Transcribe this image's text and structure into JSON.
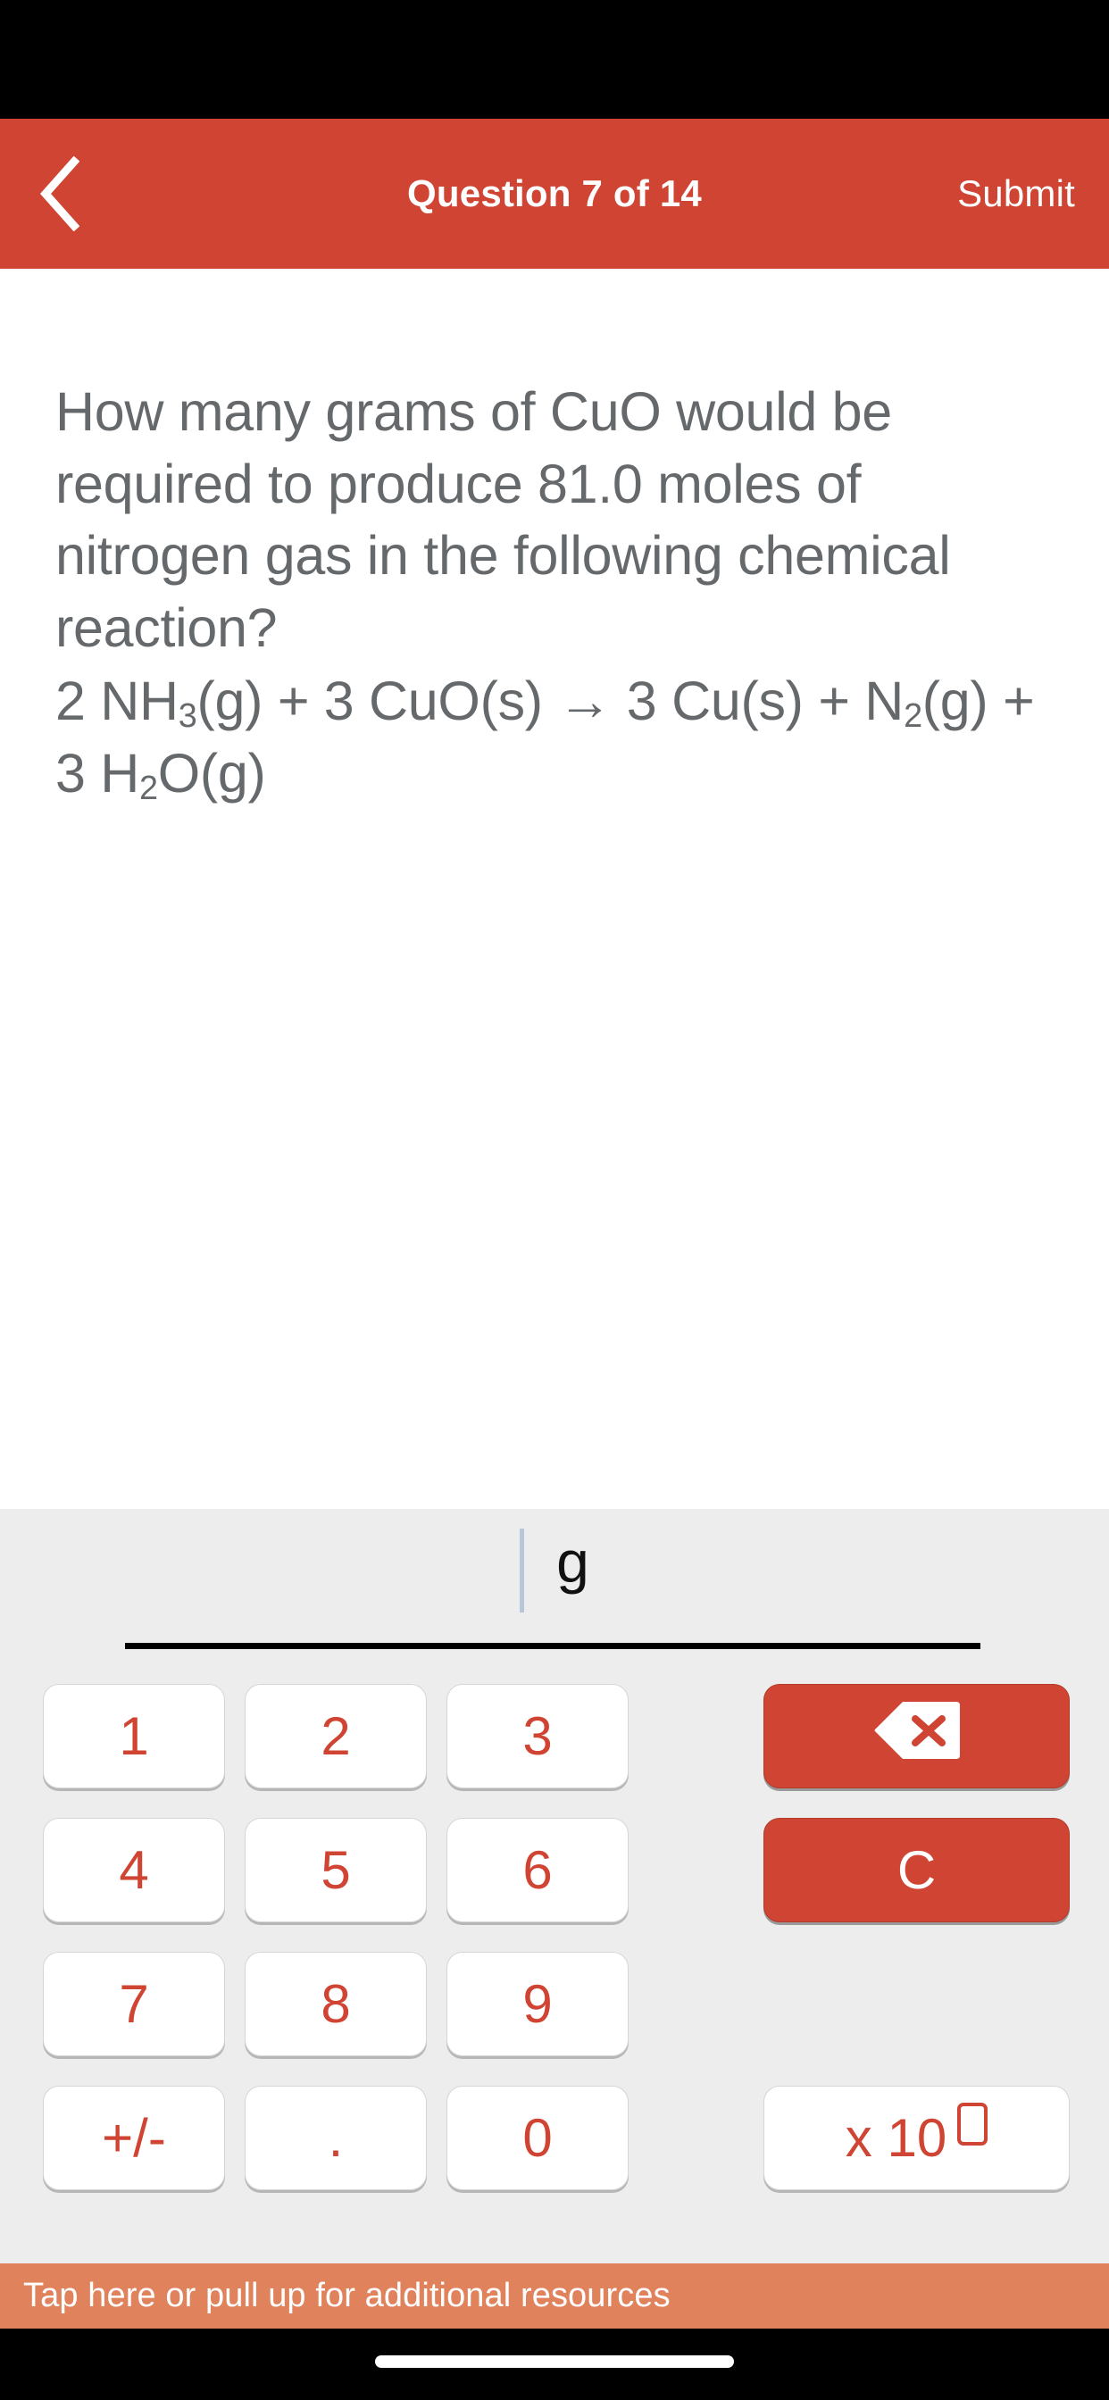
{
  "header": {
    "back_icon": "chevron-left-icon",
    "title": "Question 7 of 14",
    "submit_label": "Submit",
    "background_color": "#cf4432",
    "text_color": "#ffffff"
  },
  "question": {
    "prompt": "How many grams of CuO would be required to produce 81.0 moles of nitrogen gas in the following chemical reaction?",
    "equation_plain": "2 NH3(g) + 3 CuO(s) → 3 Cu(s) + N2(g) + 3 H2O(g)",
    "equation_parts": [
      {
        "text": "2 NH",
        "sub": false
      },
      {
        "text": "3",
        "sub": true
      },
      {
        "text": "(g) + 3 CuO(s) → 3 Cu(s) + N",
        "sub": false
      },
      {
        "text": "2",
        "sub": true
      },
      {
        "text": "(g) + 3 H",
        "sub": false
      },
      {
        "text": "2",
        "sub": true
      },
      {
        "text": "O(g)",
        "sub": false
      }
    ],
    "text_color": "#66696b"
  },
  "answer": {
    "value": "",
    "unit": "g",
    "caret_visible": true,
    "caret_color": "#b9c6da",
    "underline_color": "#000000"
  },
  "keypad": {
    "background_color": "#ededed",
    "digit_color": "#cf4432",
    "accent_color": "#cf4432",
    "keys": [
      {
        "name": "key-1",
        "label": "1",
        "style": "light"
      },
      {
        "name": "key-2",
        "label": "2",
        "style": "light"
      },
      {
        "name": "key-3",
        "label": "3",
        "style": "light"
      },
      {
        "name": "key-backspace",
        "label": "",
        "style": "accent",
        "icon": "backspace-icon"
      },
      {
        "name": "key-4",
        "label": "4",
        "style": "light"
      },
      {
        "name": "key-5",
        "label": "5",
        "style": "light"
      },
      {
        "name": "key-6",
        "label": "6",
        "style": "light"
      },
      {
        "name": "key-clear",
        "label": "C",
        "style": "accent"
      },
      {
        "name": "key-7",
        "label": "7",
        "style": "light"
      },
      {
        "name": "key-8",
        "label": "8",
        "style": "light"
      },
      {
        "name": "key-9",
        "label": "9",
        "style": "light"
      },
      {
        "name": "key-plus-minus",
        "label": "+/-",
        "style": "light"
      },
      {
        "name": "key-decimal",
        "label": ".",
        "style": "light"
      },
      {
        "name": "key-0",
        "label": "0",
        "style": "light"
      },
      {
        "name": "key-exponent",
        "label": "x 10",
        "style": "light",
        "exponent_box": true
      }
    ]
  },
  "resources": {
    "label": "Tap here or pull up for additional resources",
    "background_color": "#e0835c",
    "text_color": "#ffffff"
  }
}
